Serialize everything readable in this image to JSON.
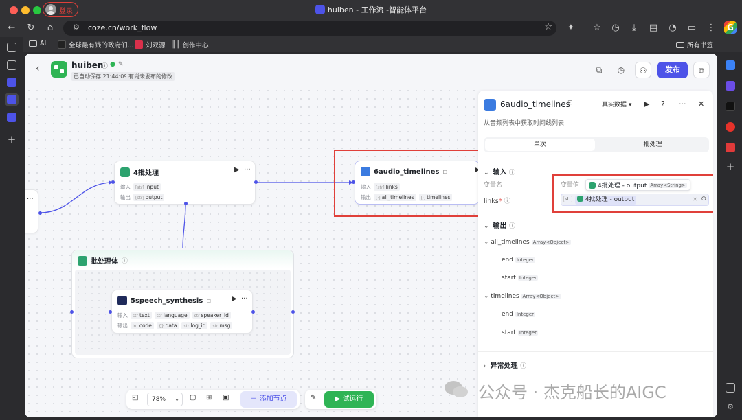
{
  "window": {
    "title": "huiben - 工作流 -智能体平台",
    "profile_label": "登录"
  },
  "browser": {
    "url": "coze.cn/work_flow",
    "bookmarks": [
      "AI",
      "全球最有钱的政府们...",
      "刘双源",
      "创作中心",
      "所有书签"
    ]
  },
  "header": {
    "app_name": "huiben",
    "autosave": "已自动保存 21:44:09",
    "unpublished": "有尚未发布的修改",
    "publish_label": "发布"
  },
  "canvas": {
    "io_in": "输入",
    "io_out": "输出",
    "batch_node": {
      "title": "4批处理",
      "input": "input",
      "output": "output"
    },
    "audio_node": {
      "title": "6audio_timelines",
      "input": "links",
      "output_1": "all_timelines",
      "output_2": "timelines"
    },
    "batch_body": {
      "title": "批处理体"
    },
    "speech_node": {
      "title": "5speech_synthesis",
      "inputs": [
        "text",
        "language",
        "speaker_id"
      ],
      "outputs": [
        "code",
        "data",
        "log_id",
        "msg"
      ]
    },
    "left_node_more": "···"
  },
  "toolbar": {
    "zoom": "78%",
    "add_node": "添加节点",
    "test_run": "试运行"
  },
  "panel": {
    "title": "6audio_timelines",
    "real_data": "真实数据",
    "description": "从音频列表中获取时间线列表",
    "tab_single": "单次",
    "tab_batch": "批处理",
    "input_section": "输入",
    "var_name_label": "变量名",
    "var_value_label": "变量值",
    "input_var": "links",
    "input_required": "*",
    "tooltip_ref": "4批处理 - output",
    "tooltip_type": "Array<String>",
    "input_type_tag": "str",
    "ref_value": "4批处理 - output",
    "output_section": "输出",
    "outputs": [
      {
        "name": "all_timelines",
        "type": "Array<Object>",
        "children": [
          {
            "name": "end",
            "type": "Integer"
          },
          {
            "name": "start",
            "type": "Integer"
          }
        ]
      },
      {
        "name": "timelines",
        "type": "Array<Object>",
        "children": [
          {
            "name": "end",
            "type": "Integer"
          },
          {
            "name": "start",
            "type": "Integer"
          }
        ]
      }
    ],
    "exception_section": "异常处理"
  },
  "watermark": "公众号 · 杰克船长的AIGC"
}
